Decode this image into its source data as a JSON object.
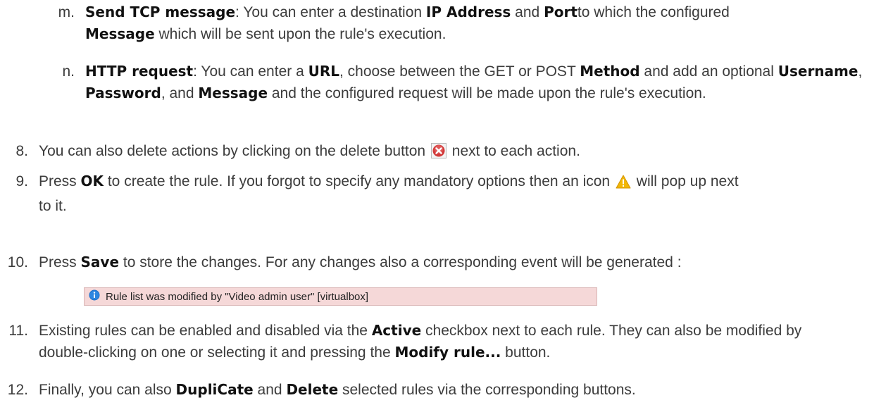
{
  "items": [
    {
      "marker": "m.",
      "parts": [
        {
          "kw": "Send TCP message"
        },
        {
          "t": ": You can enter a destination "
        },
        {
          "kw": "IP Address"
        },
        {
          "t": " and "
        },
        {
          "kw": "Port"
        },
        {
          "t": "to which the configured "
        },
        {
          "kw": "Message"
        },
        {
          "t": " which will be sent upon the rule's execution."
        }
      ]
    },
    {
      "marker": "n.",
      "parts": [
        {
          "kw": "HTTP request"
        },
        {
          "t": ": You can enter a "
        },
        {
          "kw": "URL"
        },
        {
          "t": ", choose between the GET or POST "
        },
        {
          "kw": "Method"
        },
        {
          "t": " and add an optional "
        },
        {
          "kw": "Username"
        },
        {
          "t": ", "
        },
        {
          "kw": "Password"
        },
        {
          "t": ", and "
        },
        {
          "kw": "Message"
        },
        {
          "t": " and the configured request will be made upon the rule's execution."
        }
      ]
    },
    {
      "marker": "8.",
      "parts": [
        {
          "t": "You can also delete actions by clicking on the delete button "
        },
        {
          "icon": "delete-icon"
        },
        {
          "t": " next to each action."
        }
      ]
    },
    {
      "marker": "9.",
      "parts": [
        {
          "t": "Press "
        },
        {
          "kw": "OK"
        },
        {
          "t": " to create the rule. If you forgot to specify any mandatory options then an icon "
        },
        {
          "icon": "warning-icon"
        },
        {
          "t": " will pop up next to it."
        }
      ]
    },
    {
      "marker": "10.",
      "parts": [
        {
          "t": "Press "
        },
        {
          "kw": "Save"
        },
        {
          "t": " to store the changes. For any changes also a corresponding event will be generated :"
        }
      ]
    },
    {
      "marker": "11.",
      "parts": [
        {
          "t": "Existing rules can be enabled and disabled via the "
        },
        {
          "kw": "Active"
        },
        {
          "t": " checkbox next to each rule. They can also be modified by double-clicking on one or selecting it and pressing the "
        },
        {
          "kw": "Modify rule..."
        },
        {
          "t": " button."
        }
      ]
    },
    {
      "marker": "12.",
      "parts": [
        {
          "t": "Finally, you can also "
        },
        {
          "kw": "DupliCate"
        },
        {
          "t": " and "
        },
        {
          "kw": "Delete"
        },
        {
          "t": " selected rules via the corresponding buttons."
        }
      ]
    }
  ],
  "event_message": "Rule list was modified by \"Video admin user\" [virtualbox]",
  "colors": {
    "delete_icon": "#d23a3a",
    "warning_icon": "#f2b705",
    "info_icon": "#1b6fc9",
    "event_bg": "#f5d8d8"
  }
}
